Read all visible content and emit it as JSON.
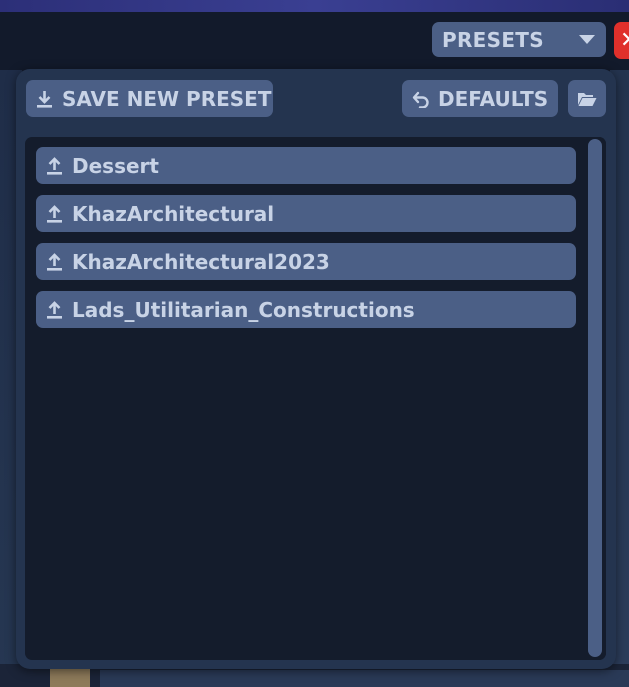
{
  "header": {
    "presets_dropdown": {
      "selected_label": "PRESETS",
      "icon": "chevron-down-icon"
    },
    "close_button": {
      "icon": "close-icon",
      "color": "#e0302b"
    }
  },
  "presets_panel": {
    "save_button": {
      "label": "SAVE NEW PRESET",
      "icon": "download-icon"
    },
    "defaults_button": {
      "label": "DEFAULTS",
      "icon": "undo-icon"
    },
    "folder_button": {
      "icon": "folder-open-icon"
    },
    "items": [
      {
        "label": "Dessert",
        "icon": "upload-icon"
      },
      {
        "label": "KhazArchitectural",
        "icon": "upload-icon"
      },
      {
        "label": "KhazArchitectural2023",
        "icon": "upload-icon"
      },
      {
        "label": "Lads_Utilitarian_Constructions",
        "icon": "upload-icon"
      }
    ]
  },
  "colors": {
    "panel_background": "#24344f",
    "list_background": "#141c2c",
    "button_fill": "#4b5f86",
    "text": "#c8d3e6",
    "close_red": "#e0302b"
  }
}
